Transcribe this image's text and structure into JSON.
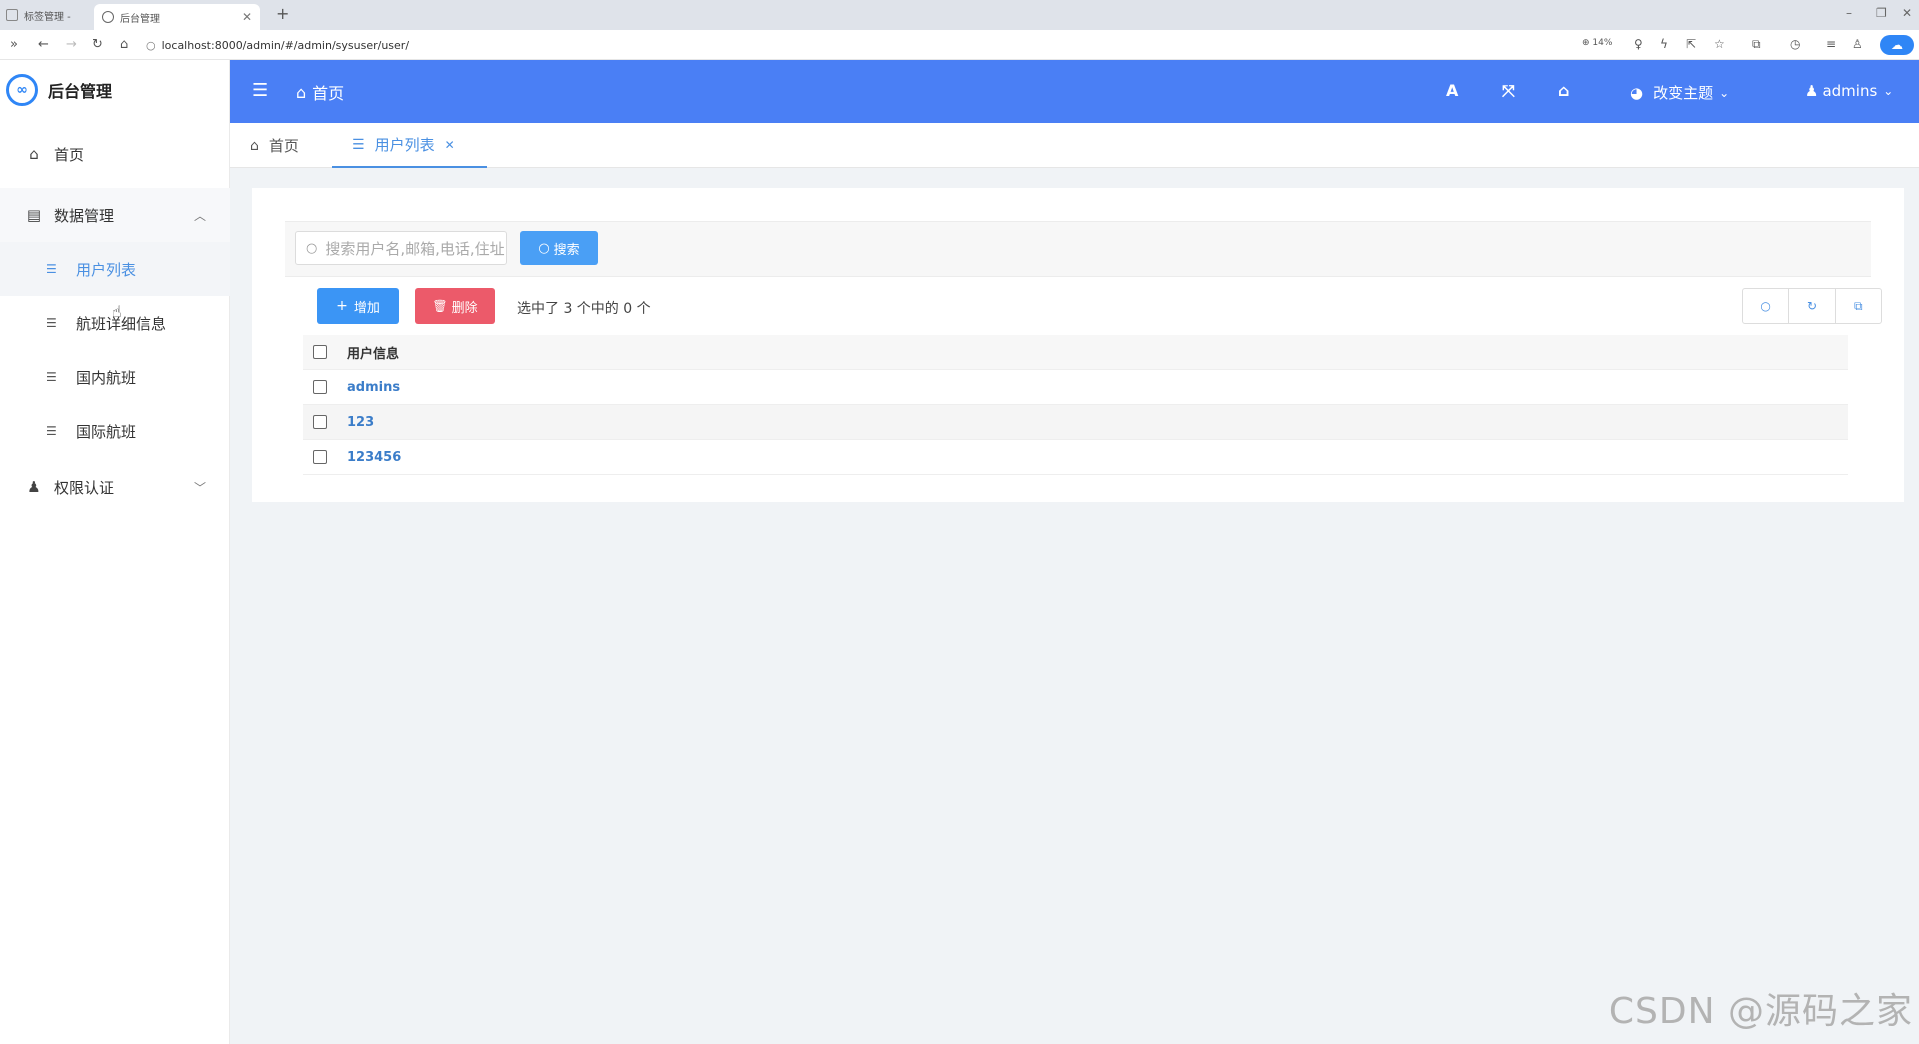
{
  "browser": {
    "tab1_label": "标签管理 -",
    "tab2_label": "后台管理",
    "url": "localhost:8000/admin/#/admin/sysuser/user/",
    "zoom": "14%"
  },
  "sidebar": {
    "logo_text": "后台管理",
    "home_label": "首页",
    "data_mgmt_label": "数据管理",
    "sub_items": [
      "用户列表",
      "航班详细信息",
      "国内航班",
      "国际航班"
    ],
    "auth_label": "权限认证"
  },
  "header": {
    "home_label": "首页",
    "theme_label": "改变主题",
    "user_label": "admins"
  },
  "page_tabs": {
    "home_label": "首页",
    "user_list_label": "用户列表"
  },
  "toolbar": {
    "search_placeholder": "搜索用户名,邮箱,电话,住址",
    "search_button": "搜索",
    "add_button": "增加",
    "delete_button": "删除",
    "selection_text": "选中了 3 个中的 0 个"
  },
  "table": {
    "header": "用户信息",
    "rows": [
      "admins",
      "123",
      "123456"
    ]
  },
  "watermark": "CSDN @源码之家",
  "colors": {
    "header_bg": "#4a7ff5",
    "accent": "#4a90e2",
    "add_button": "#3b95f5",
    "delete_button": "#ec5a6a"
  }
}
